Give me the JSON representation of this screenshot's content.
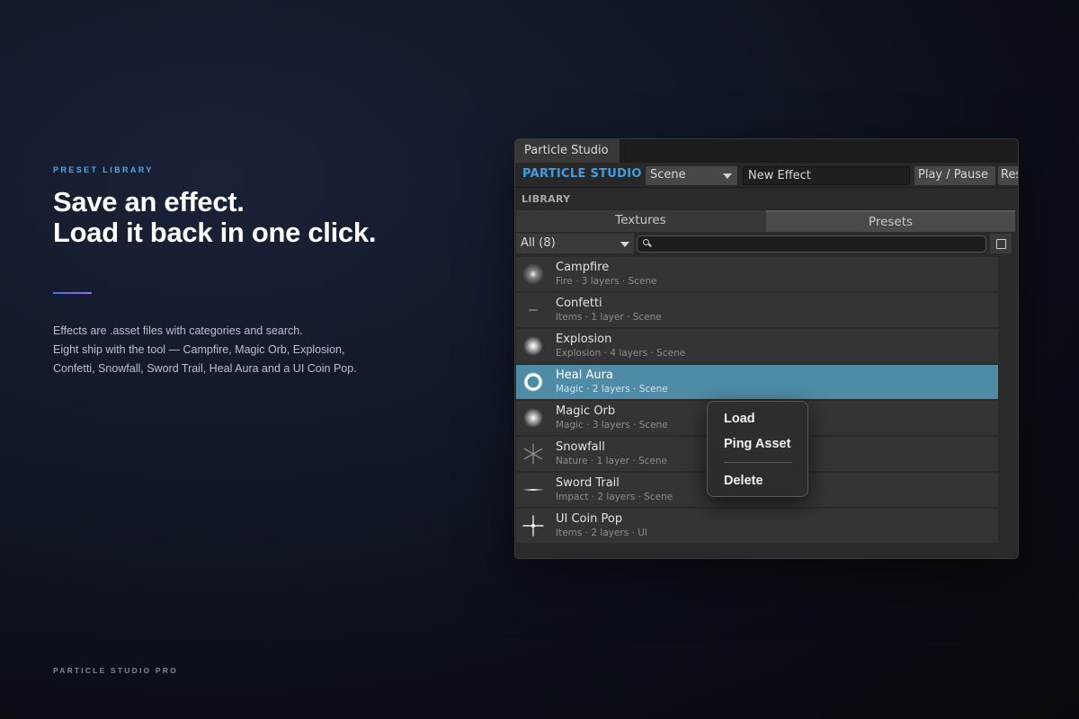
{
  "hero": {
    "eyebrow": "PRESET LIBRARY",
    "headline": [
      "Save an effect.",
      "Load it back in one click."
    ],
    "description": [
      "Effects are .asset files with categories and search.",
      "Eight ship with the tool — Campfire, Magic Orb, Explosion,",
      "Confetti, Snowfall, Sword Trail, Heal Aura and a UI Coin Pop."
    ],
    "footer": "PARTICLE STUDIO PRO"
  },
  "window": {
    "tab_title": "Particle Studio",
    "toolbar": {
      "brand": "PARTICLE STUDIO",
      "scene_select": "Scene",
      "effect_name": "New Effect",
      "play_pause": "Play / Pause",
      "reset": "Reset"
    },
    "section_label": "LIBRARY",
    "tabs": [
      {
        "label": "Textures",
        "active": false
      },
      {
        "label": "Presets",
        "active": true
      }
    ],
    "category_filter": "All (8)",
    "search": {
      "value": ""
    },
    "presets": [
      {
        "name": "Campfire",
        "meta": "Fire · 3 layers · Scene",
        "icon": "soft-glow-icon",
        "selected": false
      },
      {
        "name": "Confetti",
        "meta": "Items · 1 layer · Scene",
        "icon": "dash-icon",
        "selected": false
      },
      {
        "name": "Explosion",
        "meta": "Explosion · 4 layers · Scene",
        "icon": "bright-glow-icon",
        "selected": false
      },
      {
        "name": "Heal Aura",
        "meta": "Magic · 2 layers · Scene",
        "icon": "ring-icon",
        "selected": true
      },
      {
        "name": "Magic Orb",
        "meta": "Magic · 3 layers · Scene",
        "icon": "bright-glow-icon",
        "selected": false
      },
      {
        "name": "Snowfall",
        "meta": "Nature · 1 layer · Scene",
        "icon": "snowflake-icon",
        "selected": false
      },
      {
        "name": "Sword Trail",
        "meta": "Impact · 2 layers · Scene",
        "icon": "streak-icon",
        "selected": false
      },
      {
        "name": "UI Coin Pop",
        "meta": "Items · 2 layers · UI",
        "icon": "sparkle-icon",
        "selected": false
      }
    ]
  },
  "context_menu": {
    "items": [
      "Load",
      "Ping Asset",
      "Delete"
    ]
  },
  "colors": {
    "accent_blue": "#3e9ee4",
    "selection": "#4d8ba6",
    "eyebrow": "#52a8e6"
  }
}
